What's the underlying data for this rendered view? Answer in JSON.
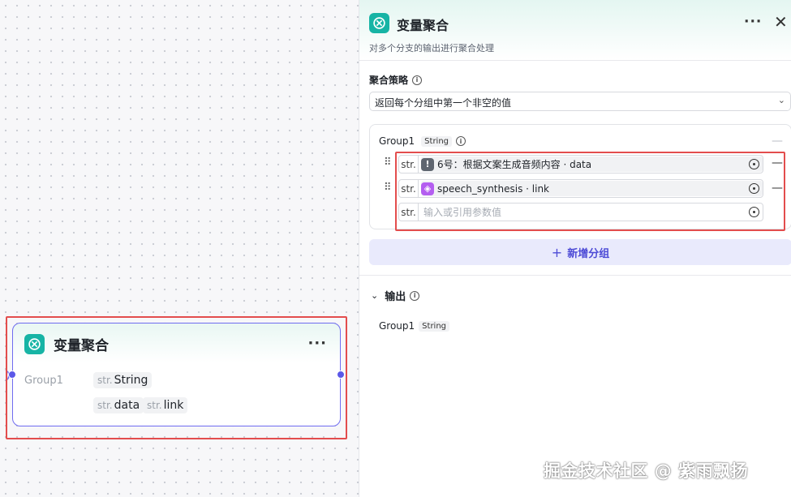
{
  "node": {
    "title": "变量聚合",
    "more": "···",
    "group_label": "Group1",
    "type_prefix": "str.",
    "type_value": "String",
    "ref1_prefix": "str.",
    "ref1_value": "data",
    "ref2_prefix": "str.",
    "ref2_value": "link"
  },
  "panel": {
    "title": "变量聚合",
    "more": "···",
    "close": "✕",
    "description": "对多个分支的输出进行聚合处理",
    "strategy_label": "聚合策略",
    "strategy_value": "返回每个分组中第一个非空的值",
    "group": {
      "name": "Group1",
      "type": "String",
      "rows": [
        {
          "prefix": "str.",
          "ref_text": "6号：根据文案生成音频内容 · data",
          "icon": "warning-node-icon",
          "icon_color": "#5f6670",
          "icon_glyph": "!"
        },
        {
          "prefix": "str.",
          "ref_text": "speech_synthesis · link",
          "icon": "cube-node-icon",
          "icon_color": "#b45ef0",
          "icon_glyph": "◈"
        },
        {
          "prefix": "str.",
          "placeholder": "输入或引用参数值"
        }
      ]
    },
    "add_group_label": "新增分组",
    "output_label": "输出",
    "output_item": {
      "name": "Group1",
      "type": "String"
    }
  },
  "watermark": "掘金技术社区 @ 紫雨飘扬",
  "colors": {
    "accent": "#5b58e8",
    "teal": "#17b4a5",
    "highlight": "#e34d4d"
  }
}
